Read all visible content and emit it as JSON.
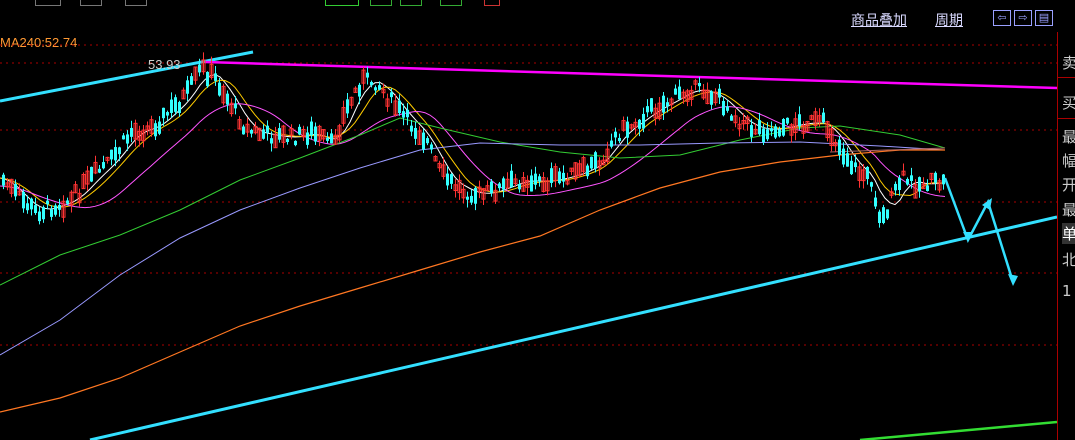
{
  "toolbar": {
    "add_product": "商品叠加",
    "period": "周期",
    "nav_icons": [
      "arrow-left-icon",
      "arrow-right-icon",
      "panel-icon"
    ]
  },
  "indicator": {
    "label": "MA240:52.74"
  },
  "right_panel": {
    "items": [
      "卖",
      "买",
      "最",
      "幅",
      "开",
      "最",
      "单",
      "北",
      "1"
    ],
    "selected_index": 6
  },
  "colors": {
    "background": "#000000",
    "up_candle": "#ff3333",
    "down_candle": "#33ffff",
    "trendline": "#33e0ff",
    "resistance": "#ff00ff",
    "ma_short": "#ffffff",
    "ma_yellow": "#ffcc00",
    "ma_magenta": "#ff55ff",
    "ma_green": "#33cc33",
    "ma_purple": "#9999ff",
    "ma_orange": "#ff7722",
    "grid": "#aa0000"
  },
  "chart_data": {
    "type": "candlestick",
    "annotations": [
      {
        "text": "53.93",
        "kind": "peak-price"
      }
    ],
    "indicators": [
      "MA240"
    ],
    "grid": true
  }
}
